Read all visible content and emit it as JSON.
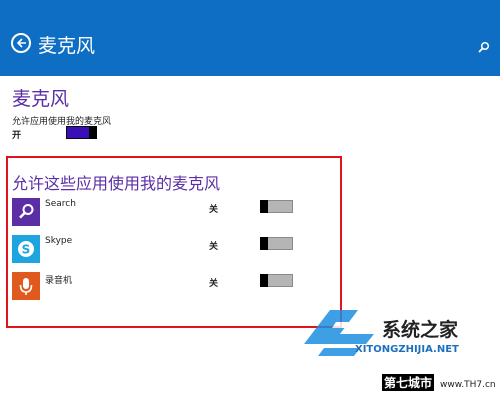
{
  "header": {
    "title": "麦克风"
  },
  "section": {
    "title": "麦克风",
    "setting_label": "允许应用使用我的麦克风",
    "state_label": "开"
  },
  "apps": {
    "title": "允许这些应用使用我的麦克风",
    "items": [
      {
        "name": "Search",
        "state": "关",
        "icon": "search-icon",
        "color": "#5b2ea6"
      },
      {
        "name": "Skype",
        "state": "关",
        "icon": "skype-icon",
        "color": "#1ea5e0"
      },
      {
        "name": "录音机",
        "state": "关",
        "icon": "microphone-icon",
        "color": "#e05a1f"
      }
    ]
  },
  "watermark": {
    "site_name": "系统之家",
    "site_url": "XITONGZHIJIA.NET",
    "badge": "第七城市",
    "badge_url": "www.TH7.cn"
  },
  "colors": {
    "header": "#0d6ec3",
    "accent_purple": "#5b2ea6",
    "highlight_box": "#e0131a"
  }
}
